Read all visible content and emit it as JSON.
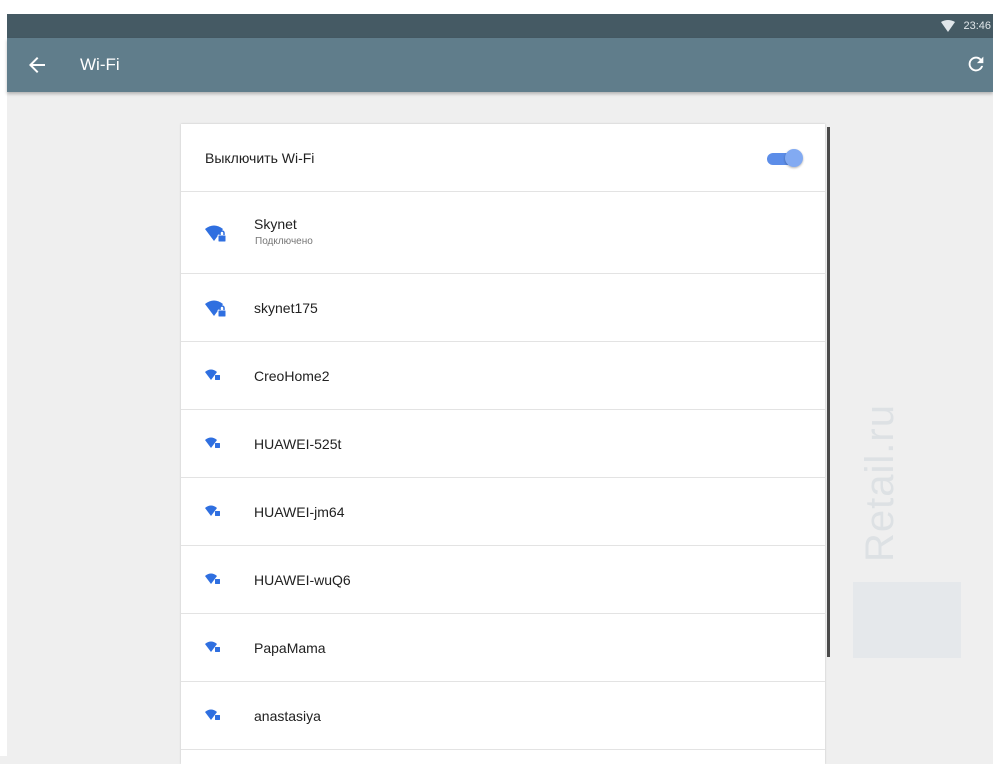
{
  "status_bar": {
    "time": "23:46",
    "wifi_icon": "wifi-icon"
  },
  "app_bar": {
    "title": "Wi-Fi",
    "back_icon": "arrow-back-icon",
    "refresh_icon": "refresh-icon",
    "background": "#607d8b"
  },
  "wifi_toggle": {
    "label": "Выключить Wi-Fi",
    "enabled": true,
    "accent": "#5c8de8"
  },
  "networks": [
    {
      "name": "Skynet",
      "status": "Подключено",
      "signal": "strong",
      "secured": true
    },
    {
      "name": "skynet175",
      "signal": "strong",
      "secured": true
    },
    {
      "name": "CreoHome2",
      "signal": "weak",
      "secured": true
    },
    {
      "name": "HUAWEI-525t",
      "signal": "weak",
      "secured": true
    },
    {
      "name": "HUAWEI-jm64",
      "signal": "weak",
      "secured": true
    },
    {
      "name": "HUAWEI-wuQ6",
      "signal": "weak",
      "secured": true
    },
    {
      "name": "PapaMama",
      "signal": "weak",
      "secured": true
    },
    {
      "name": "anastasiya",
      "signal": "weak",
      "secured": true
    }
  ],
  "watermark": {
    "text": "Retail.ru"
  }
}
